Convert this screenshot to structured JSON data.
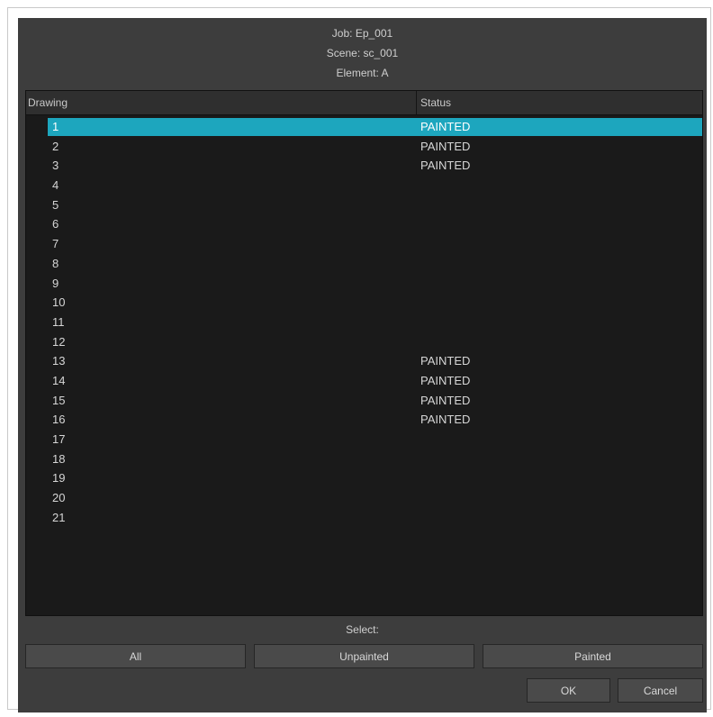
{
  "header": {
    "job": "Job: Ep_001",
    "scene": "Scene: sc_001",
    "element": "Element: A"
  },
  "columns": {
    "drawing": "Drawing",
    "status": "Status"
  },
  "rows": [
    {
      "drawing": "1",
      "status": "PAINTED",
      "selected": true
    },
    {
      "drawing": "2",
      "status": "PAINTED"
    },
    {
      "drawing": "3",
      "status": "PAINTED"
    },
    {
      "drawing": "4",
      "status": ""
    },
    {
      "drawing": "5",
      "status": ""
    },
    {
      "drawing": "6",
      "status": ""
    },
    {
      "drawing": "7",
      "status": ""
    },
    {
      "drawing": "8",
      "status": ""
    },
    {
      "drawing": "9",
      "status": ""
    },
    {
      "drawing": "10",
      "status": ""
    },
    {
      "drawing": "11",
      "status": ""
    },
    {
      "drawing": "12",
      "status": ""
    },
    {
      "drawing": "13",
      "status": "PAINTED"
    },
    {
      "drawing": "14",
      "status": "PAINTED"
    },
    {
      "drawing": "15",
      "status": "PAINTED"
    },
    {
      "drawing": "16",
      "status": "PAINTED"
    },
    {
      "drawing": "17",
      "status": ""
    },
    {
      "drawing": "18",
      "status": ""
    },
    {
      "drawing": "19",
      "status": ""
    },
    {
      "drawing": "20",
      "status": ""
    },
    {
      "drawing": "21",
      "status": ""
    }
  ],
  "select": {
    "label": "Select:",
    "all": "All",
    "unpainted": "Unpainted",
    "painted": "Painted"
  },
  "footer": {
    "ok": "OK",
    "cancel": "Cancel"
  },
  "colors": {
    "dialog_bg": "#3d3d3d",
    "list_bg": "#1a1a1a",
    "selection": "#1da6be"
  }
}
